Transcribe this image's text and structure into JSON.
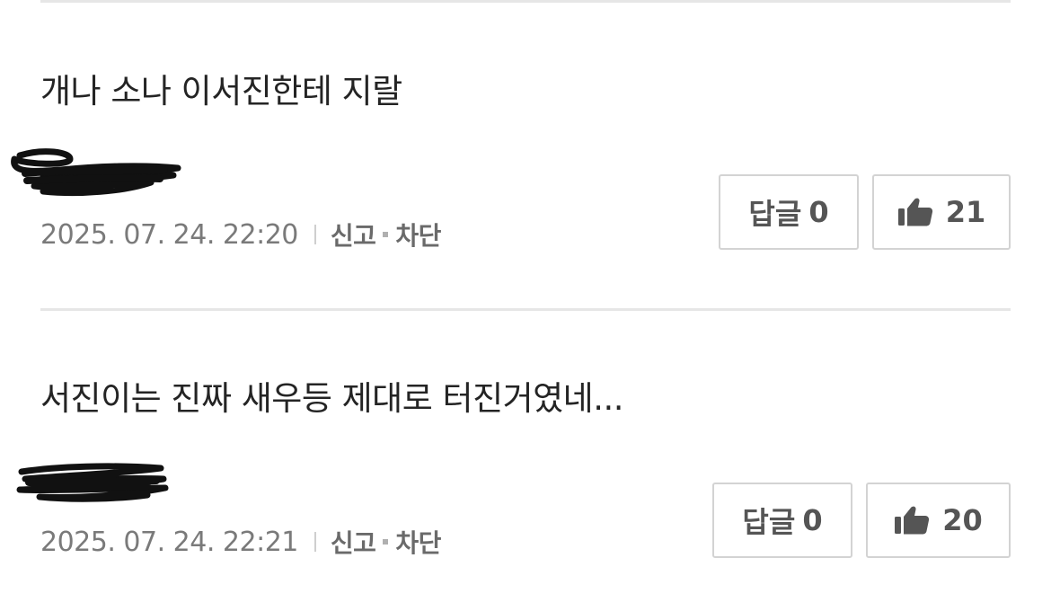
{
  "comments": [
    {
      "text": "개나 소나 이서진한테 지랄",
      "timestamp": "2025. 07. 24. 22:20",
      "report_label": "신고",
      "block_label": "차단",
      "reply_label": "답글",
      "reply_count": "0",
      "like_count": "21"
    },
    {
      "text": "서진이는 진짜 새우등 제대로 터진거였네...",
      "timestamp": "2025. 07. 24. 22:21",
      "report_label": "신고",
      "block_label": "차단",
      "reply_label": "답글",
      "reply_count": "0",
      "like_count": "20"
    }
  ],
  "icons": {
    "like": "thumbs-up-icon"
  },
  "colors": {
    "text": "#242424",
    "meta": "#7a7a7a",
    "border": "#d3d3d3",
    "divider": "#e6e6e6"
  }
}
